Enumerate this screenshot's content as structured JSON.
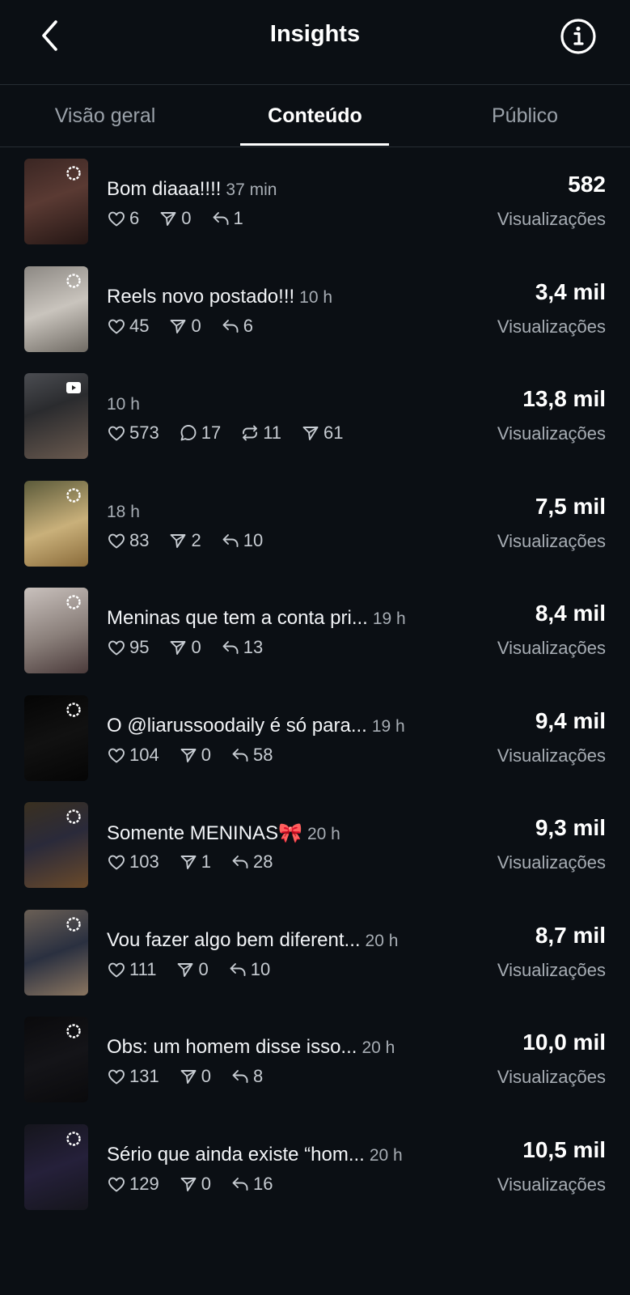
{
  "header": {
    "title": "Insights"
  },
  "tabs": [
    {
      "label": "Visão geral"
    },
    {
      "label": "Conteúdo"
    },
    {
      "label": "Público"
    }
  ],
  "views_label": "Visualizações",
  "items": [
    {
      "caption": "Bom diaaa!!!!",
      "time": "37 min",
      "likes": "6",
      "shares": "0",
      "replies": "1",
      "views": "582"
    },
    {
      "caption": "Reels novo postado!!!",
      "time": "10 h",
      "likes": "45",
      "shares": "0",
      "replies": "6",
      "views": "3,4 mil"
    },
    {
      "caption": "",
      "time": "10 h",
      "likes": "573",
      "comments": "17",
      "reposts": "11",
      "shares": "61",
      "views": "13,8 mil"
    },
    {
      "caption": "",
      "time": "18 h",
      "likes": "83",
      "shares": "2",
      "replies": "10",
      "views": "7,5 mil"
    },
    {
      "caption": "Meninas que tem a conta pri...",
      "time": "19 h",
      "likes": "95",
      "shares": "0",
      "replies": "13",
      "views": "8,4 mil"
    },
    {
      "caption": "O @liarussoodaily  é só para...",
      "time": "19 h",
      "likes": "104",
      "shares": "0",
      "replies": "58",
      "views": "9,4 mil"
    },
    {
      "caption": "Somente MENINAS🎀",
      "time": "20 h",
      "likes": "103",
      "shares": "1",
      "replies": "28",
      "views": "9,3 mil"
    },
    {
      "caption": "Vou fazer algo bem diferent...",
      "time": "20 h",
      "likes": "111",
      "shares": "0",
      "replies": "10",
      "views": "8,7 mil"
    },
    {
      "caption": "Obs: um homem disse isso...",
      "time": "20 h",
      "likes": "131",
      "shares": "0",
      "replies": "8",
      "views": "10,0 mil"
    },
    {
      "caption": "Sério que ainda existe “hom...",
      "time": "20 h",
      "likes": "129",
      "shares": "0",
      "replies": "16",
      "views": "10,5 mil"
    }
  ],
  "icons": {
    "back": "chevron-left-icon",
    "info": "info-icon",
    "likes": "heart-icon",
    "shares": "send-icon",
    "replies": "reply-icon",
    "comments": "comment-icon",
    "reposts": "repost-icon",
    "story_badge": "loading-ring-icon",
    "reel_badge": "reel-icon"
  },
  "colors": {
    "background": "#0b0f14",
    "text": "#f2f4f7",
    "muted": "#a7adb4",
    "divider": "#262c33"
  }
}
